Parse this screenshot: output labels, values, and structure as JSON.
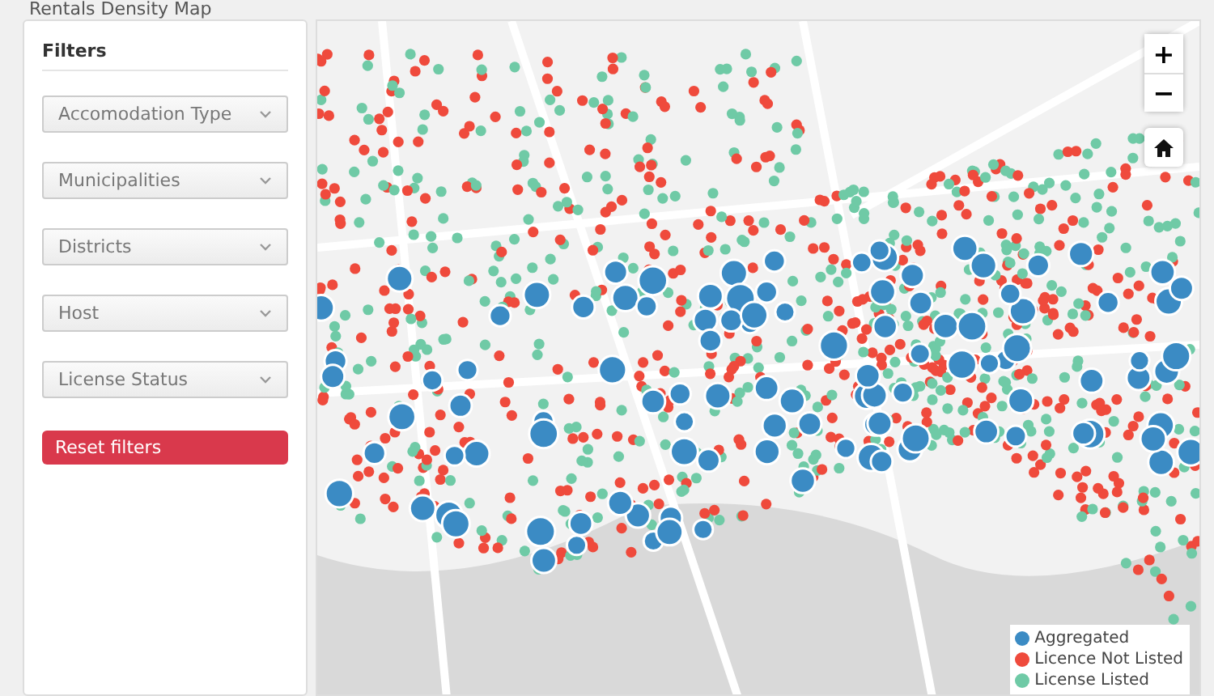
{
  "page": {
    "title": "Rentals Density Map"
  },
  "filters": {
    "title": "Filters",
    "dropdowns": [
      {
        "placeholder": "Accomodation Type"
      },
      {
        "placeholder": "Municipalities"
      },
      {
        "placeholder": "Districts"
      },
      {
        "placeholder": "Host"
      },
      {
        "placeholder": "License Status"
      }
    ],
    "reset_button": "Reset filters"
  },
  "map": {
    "zoom_in": "+",
    "zoom_out": "−",
    "legend": [
      {
        "label": "Aggregated",
        "color": "#3b8bc4"
      },
      {
        "label": "Licence Not Listed",
        "color": "#ef4a3c"
      },
      {
        "label": "License Listed",
        "color": "#6fcaa6"
      }
    ]
  }
}
